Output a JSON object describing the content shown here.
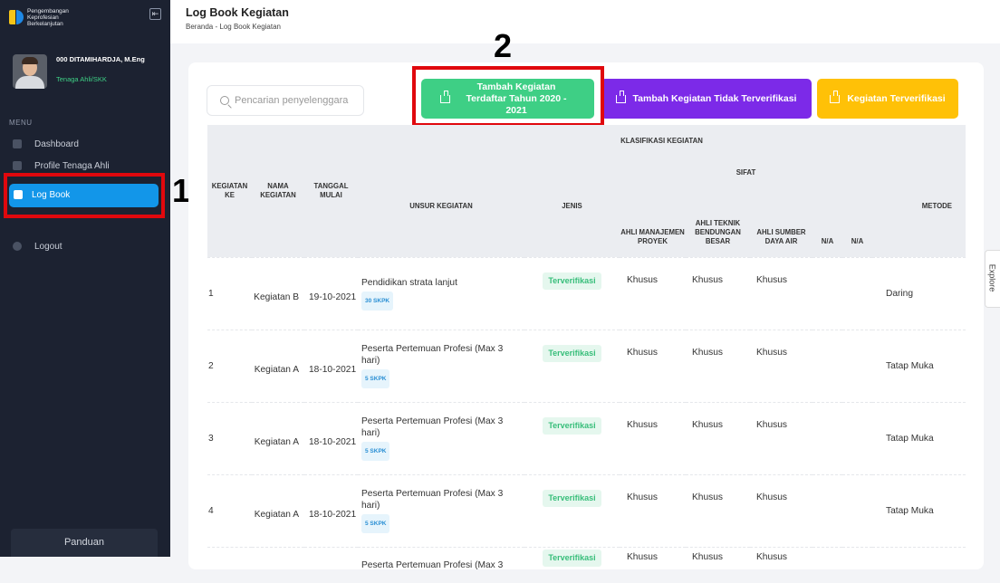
{
  "brand": {
    "logo_lines": [
      "Pengembangan",
      "Keprofesian",
      "Berkelanjutan"
    ],
    "collapse_icon": "collapse-left-icon"
  },
  "user": {
    "name": "000 DITAMIHARDJA, M.Eng",
    "role": "Tenaga Ahli/SKK"
  },
  "sidebar": {
    "menu_label": "MENU",
    "items": [
      {
        "label": "Dashboard",
        "icon": "grid-icon"
      },
      {
        "label": "Profile Tenaga Ahli",
        "icon": "user-icon"
      },
      {
        "label": "Log Book",
        "icon": "book-icon"
      },
      {
        "label": "Logout",
        "icon": "logout-icon"
      }
    ],
    "panduan": "Panduan"
  },
  "header": {
    "title": "Log Book Kegiatan",
    "breadcrumb_home": "Beranda",
    "breadcrumb_sep": "-",
    "breadcrumb_current": "Log Book Kegiatan"
  },
  "annotations": {
    "one": "1",
    "two": "2"
  },
  "search": {
    "placeholder": "Pencarian penyelenggara"
  },
  "buttons": {
    "registered": "Tambah Kegiatan Terdaftar Tahun 2020 - 2021",
    "unverified": "Tambah Kegiatan Tidak Terverifikasi",
    "verified": "Kegiatan Terverifikasi",
    "colors": {
      "green": "#3ecf85",
      "purple": "#7c2ae8",
      "yellow": "#ffc107"
    }
  },
  "table": {
    "headers": {
      "no": "KEGIATAN KE",
      "name": "NAMA KEGIATAN",
      "date": "TANGGAL MULAI",
      "klasifikasi": "KLASIFIKASI KEGIATAN",
      "unsur": "UNSUR KEGIATAN",
      "jenis": "JENIS",
      "sifat": "SIFAT",
      "s1": "AHLI MANAJEMEN PROYEK",
      "s2": "AHLI TEKNIK BENDUNGAN BESAR",
      "s3": "AHLI SUMBER DAYA AIR",
      "s4": "N/A",
      "s5": "N/A",
      "metode": "METODE"
    },
    "rows": [
      {
        "no": "1",
        "name": "Kegiatan B",
        "date": "19-10-2021",
        "unsur": "Pendidikan strata lanjut",
        "skpk": "30 SKPK",
        "jenis": "Terverifikasi",
        "s1": "Khusus",
        "s2": "Khusus",
        "s3": "Khusus",
        "metode": "Daring"
      },
      {
        "no": "2",
        "name": "Kegiatan A",
        "date": "18-10-2021",
        "unsur": "Peserta Pertemuan Profesi (Max 3 hari)",
        "skpk": "5 SKPK",
        "jenis": "Terverifikasi",
        "s1": "Khusus",
        "s2": "Khusus",
        "s3": "Khusus",
        "metode": "Tatap Muka"
      },
      {
        "no": "3",
        "name": "Kegiatan A",
        "date": "18-10-2021",
        "unsur": "Peserta Pertemuan Profesi (Max 3 hari)",
        "skpk": "5 SKPK",
        "jenis": "Terverifikasi",
        "s1": "Khusus",
        "s2": "Khusus",
        "s3": "Khusus",
        "metode": "Tatap Muka"
      },
      {
        "no": "4",
        "name": "Kegiatan A",
        "date": "18-10-2021",
        "unsur": "Peserta Pertemuan Profesi (Max 3 hari)",
        "skpk": "5 SKPK",
        "jenis": "Terverifikasi",
        "s1": "Khusus",
        "s2": "Khusus",
        "s3": "Khusus",
        "metode": "Tatap Muka"
      },
      {
        "no": "",
        "name": "",
        "date": "",
        "unsur": "Peserta Pertemuan Profesi (Max 3",
        "skpk": "",
        "jenis": "Terverifikasi",
        "s1": "Khusus",
        "s2": "Khusus",
        "s3": "Khusus",
        "metode": ""
      }
    ]
  },
  "explore": "Explore"
}
